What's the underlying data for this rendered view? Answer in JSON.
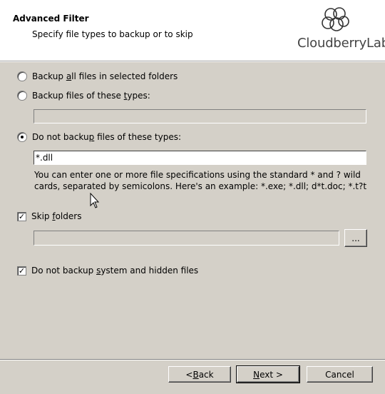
{
  "header": {
    "title": "Advanced Filter",
    "subtitle": "Specify file types to backup or to skip",
    "logo_text": "CloudberryLab"
  },
  "options": {
    "backup_all": {
      "pre": "Backup ",
      "key": "a",
      "post": "ll files in selected folders",
      "checked": false
    },
    "backup_types": {
      "pre": "Backup files of these ",
      "key": "t",
      "post": "ypes:",
      "checked": false,
      "value": ""
    },
    "skip_types": {
      "pre": "Do not backu",
      "key": "p",
      "post": " files of these types:",
      "checked": true,
      "value": "*.dll"
    }
  },
  "hint": "You can enter one or more file specifications using the standard * and ? wild cards, separated by semicolons. Here's an example: *.exe; *.dll; d*t.doc; *.t?t",
  "skip_folders": {
    "pre": "Skip ",
    "key": "f",
    "post": "olders",
    "checked": true,
    "value": "",
    "browse_label": "..."
  },
  "skip_system": {
    "pre": "Do not backup ",
    "key": "s",
    "post": "ystem and hidden files",
    "checked": true
  },
  "footer": {
    "back": {
      "pre": "< ",
      "key": "B",
      "post": "ack"
    },
    "next": {
      "pre": "",
      "key": "N",
      "post": "ext >"
    },
    "cancel": "Cancel"
  }
}
